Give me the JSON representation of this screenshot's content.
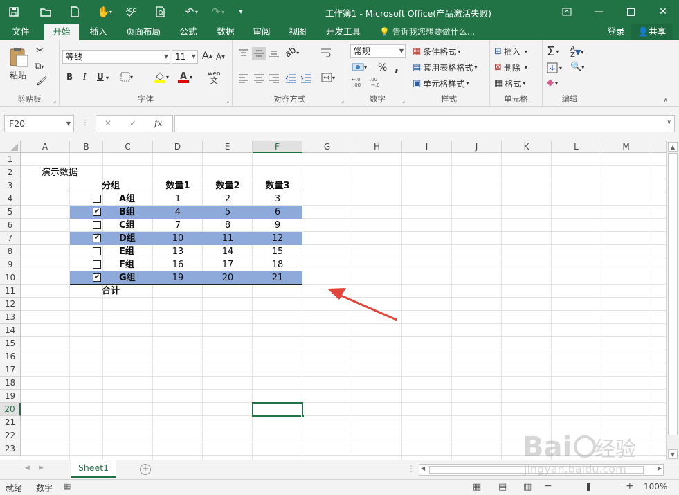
{
  "window": {
    "title": "工作簿1 - Microsoft Office(产品激活失败)"
  },
  "tabs": [
    "文件",
    "开始",
    "插入",
    "页面布局",
    "公式",
    "数据",
    "审阅",
    "视图",
    "开发工具"
  ],
  "tell_me": "告诉我您想要做什么...",
  "account": {
    "login": "登录",
    "share": "共享"
  },
  "ribbon": {
    "clipboard": {
      "label": "剪贴板",
      "paste": "粘贴"
    },
    "font": {
      "label": "字体",
      "name": "等线",
      "size": "11",
      "bold": "B",
      "italic": "I",
      "underline": "U",
      "grow": "A",
      "shrink": "A",
      "phonetic": "wén"
    },
    "alignment": {
      "label": "对齐方式"
    },
    "number": {
      "label": "数字",
      "format": "常规",
      "percent": "%",
      "comma": ","
    },
    "styles": {
      "label": "样式",
      "conditional": "条件格式",
      "table": "套用表格格式",
      "cell_styles": "单元格样式"
    },
    "cells": {
      "label": "单元格",
      "insert": "插入",
      "delete": "删除",
      "format": "格式"
    },
    "editing": {
      "label": "编辑"
    }
  },
  "formula_bar": {
    "name_box": "F20",
    "fx": "fx",
    "cancel": "✕",
    "enter": "✓",
    "formula": ""
  },
  "columns": [
    "A",
    "B",
    "C",
    "D",
    "E",
    "F",
    "G",
    "H",
    "I",
    "J",
    "K",
    "L",
    "M"
  ],
  "rows": [
    "1",
    "2",
    "3",
    "4",
    "5",
    "6",
    "7",
    "8",
    "9",
    "10",
    "11",
    "12",
    "13",
    "14",
    "15",
    "16",
    "17",
    "18",
    "19",
    "20",
    "21",
    "22",
    "23"
  ],
  "selected": {
    "column": "F",
    "row": "20"
  },
  "sheet": {
    "title": "演示数据",
    "headers": {
      "group": "分组",
      "q1": "数量1",
      "q2": "数量2",
      "q3": "数量3"
    },
    "data_rows": [
      {
        "group": "A组",
        "q1": "1",
        "q2": "2",
        "q3": "3",
        "checked": false
      },
      {
        "group": "B组",
        "q1": "4",
        "q2": "5",
        "q3": "6",
        "checked": true
      },
      {
        "group": "C组",
        "q1": "7",
        "q2": "8",
        "q3": "9",
        "checked": false
      },
      {
        "group": "D组",
        "q1": "10",
        "q2": "11",
        "q3": "12",
        "checked": true
      },
      {
        "group": "E组",
        "q1": "13",
        "q2": "14",
        "q3": "15",
        "checked": false
      },
      {
        "group": "F组",
        "q1": "16",
        "q2": "17",
        "q3": "18",
        "checked": false
      },
      {
        "group": "G组",
        "q1": "19",
        "q2": "20",
        "q3": "21",
        "checked": true
      }
    ],
    "total_label": "合计",
    "highlight_color": "#8eaadb"
  },
  "sheet_tabs": [
    "Sheet1"
  ],
  "status": {
    "ready": "就绪",
    "mode": "数字",
    "zoom": "100%"
  },
  "watermark": "Baidu经验 jingyan.baidu.com",
  "colors": {
    "accent": "#217346",
    "arrow": "#e0463c"
  }
}
